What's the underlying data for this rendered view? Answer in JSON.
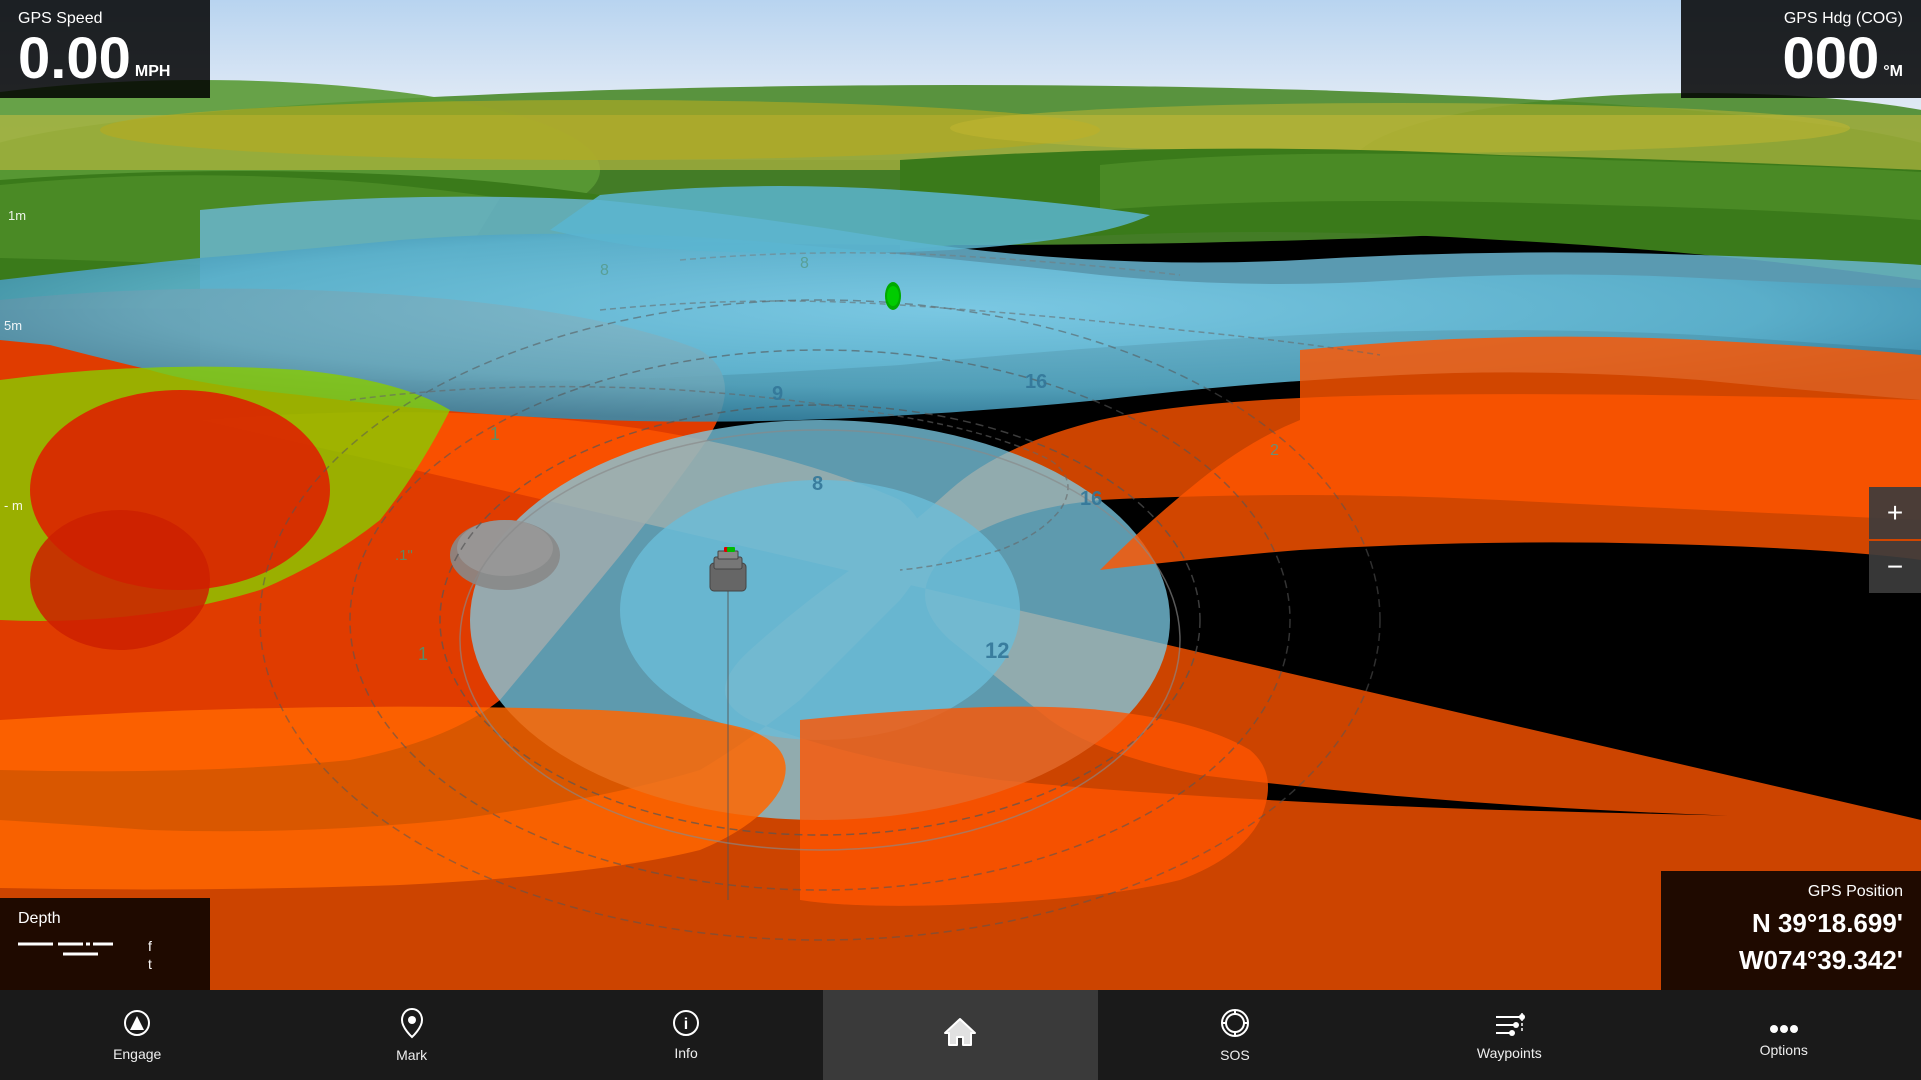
{
  "gps_speed": {
    "label": "GPS Speed",
    "value": "0.00",
    "unit_line1": "MPH",
    "unit_line2": ""
  },
  "gps_hdg": {
    "label": "GPS Hdg (COG)",
    "value": "000",
    "unit": "°M"
  },
  "depth": {
    "label": "Depth",
    "dash": "---.-",
    "unit_f": "f",
    "unit_t": "t"
  },
  "gps_position": {
    "label": "GPS Position",
    "lat": "N  39°18.699'",
    "lon": "W074°39.342'"
  },
  "zoom": {
    "plus_label": "+",
    "minus_label": "−"
  },
  "depth_scale": {
    "marks": [
      "1m",
      "5m",
      "-m"
    ]
  },
  "nav_bar": {
    "items": [
      {
        "id": "engage",
        "label": "Engage",
        "icon": "nav_engage"
      },
      {
        "id": "mark",
        "label": "Mark",
        "icon": "nav_mark"
      },
      {
        "id": "info",
        "label": "Info",
        "icon": "nav_info"
      },
      {
        "id": "home",
        "label": "",
        "icon": "nav_home",
        "active": true
      },
      {
        "id": "sos",
        "label": "SOS",
        "icon": "nav_sos"
      },
      {
        "id": "waypoints",
        "label": "Waypoints",
        "icon": "nav_waypoints"
      },
      {
        "id": "options",
        "label": "Options",
        "icon": "nav_options"
      }
    ]
  },
  "map": {
    "depth_numbers": [
      "1",
      "8",
      "9",
      "16",
      "16",
      "12",
      "2",
      "8",
      "1",
      ".1"
    ],
    "scale_marks": [
      "1m",
      "5m"
    ]
  }
}
